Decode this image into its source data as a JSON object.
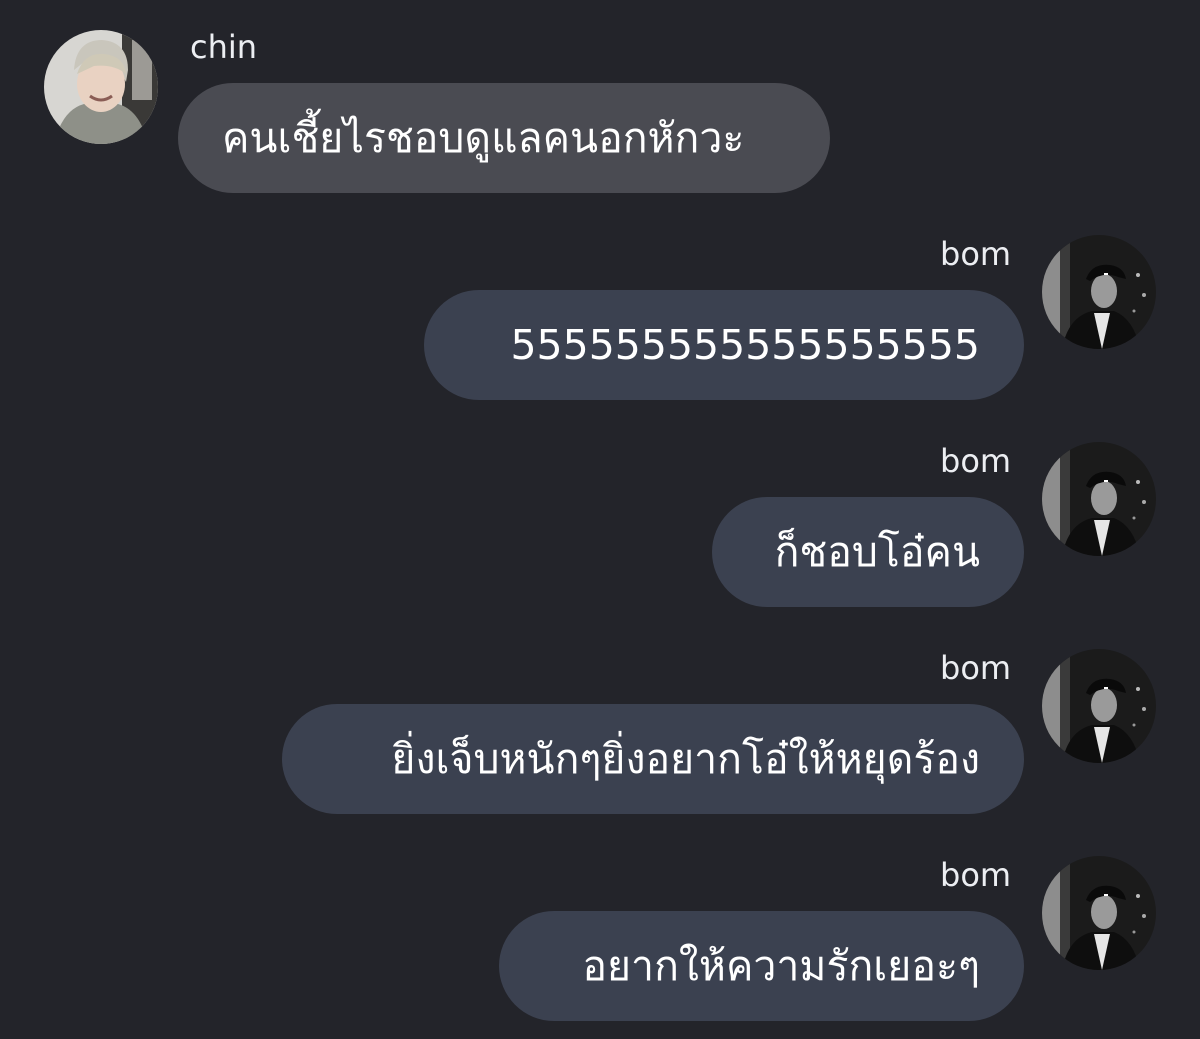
{
  "messages": [
    {
      "sender": "chin",
      "text": "คนเชี้ยไรชอบดูแลคนอกหักวะ"
    },
    {
      "sender": "bom",
      "text": "555555555555555555"
    },
    {
      "sender": "bom",
      "text": "ก็ชอบโอ๋คน"
    },
    {
      "sender": "bom",
      "text": "ยิ่งเจ็บหนักๆยิ่งอยากโอ๋ให้หยุดร้อง"
    },
    {
      "sender": "bom",
      "text": "อยากให้ความรักเยอะๆ"
    }
  ],
  "colors": {
    "background": "#23242a",
    "incoming_bubble": "#4a4b52",
    "outgoing_bubble": "#3b4150",
    "text": "#ffffff"
  }
}
